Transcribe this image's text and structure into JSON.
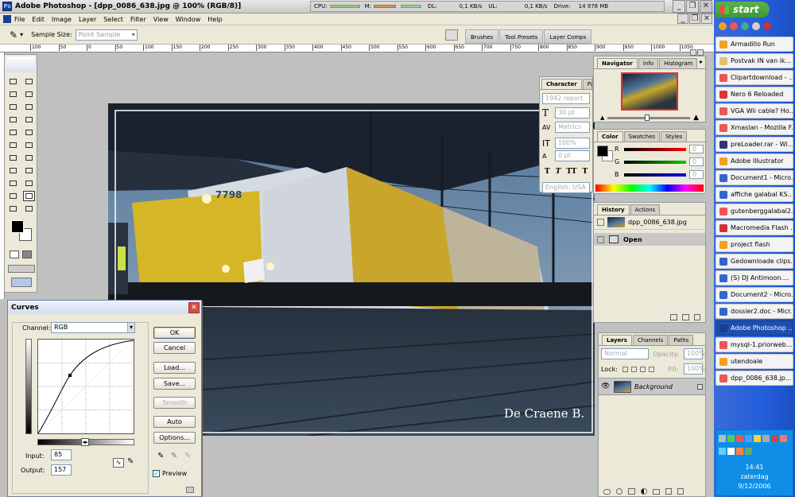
{
  "titlebar": {
    "app_title": "Adobe Photoshop - [dpp_0086_638.jpg @ 100% (RGB/8)]"
  },
  "sysmon": {
    "cpu_label": "CPU:",
    "mem_label": "M:",
    "dl_label": "DL:",
    "dl_value": "0,1 KB/s",
    "ul_label": "UL:",
    "ul_value": "0,1 KB/s",
    "drive_label": "Drive:",
    "drive_value": "14 978 MB"
  },
  "menu": [
    "File",
    "Edit",
    "Image",
    "Layer",
    "Select",
    "Filter",
    "View",
    "Window",
    "Help"
  ],
  "options": {
    "sample_label": "Sample Size:",
    "sample_value": "Point Sample"
  },
  "well_tabs": [
    "Brushes",
    "Tool Presets",
    "Layer Comps"
  ],
  "ruler": [
    "100",
    "50",
    "0",
    "50",
    "100",
    "150",
    "200",
    "250",
    "300",
    "350",
    "400",
    "450",
    "500",
    "550",
    "600",
    "650",
    "700",
    "750",
    "800",
    "850",
    "900",
    "950",
    "1000",
    "1050"
  ],
  "image": {
    "watermark": "De Craene B.",
    "loco_number": "7798"
  },
  "curves": {
    "title": "Curves",
    "channel_label": "Channel:",
    "channel_value": "RGB",
    "ok": "OK",
    "cancel": "Cancel",
    "load": "Load...",
    "save": "Save...",
    "smooth": "Smooth",
    "auto": "Auto",
    "options": "Options...",
    "input_label": "Input:",
    "input_value": "85",
    "output_label": "Output:",
    "output_value": "157",
    "preview_label": "Preview"
  },
  "character": {
    "tab1": "Character",
    "tab2": "Para",
    "font": "1942 report",
    "size": "30 pt",
    "tracking": "Metrics",
    "scale": "100%",
    "baseline": "0 pt",
    "styles": [
      "T",
      "T",
      "TT",
      "T"
    ],
    "language": "English: USA"
  },
  "navigator": {
    "tabs": [
      "Navigator",
      "Info",
      "Histogram"
    ]
  },
  "color": {
    "tabs": [
      "Color",
      "Swatches",
      "Styles"
    ],
    "r_label": "R",
    "g_label": "G",
    "b_label": "B",
    "r_value": "0",
    "g_value": "0",
    "b_value": "0"
  },
  "history": {
    "tabs": [
      "History",
      "Actions"
    ],
    "snapshot": "dpp_0086_638.jpg",
    "step": "Open"
  },
  "layers": {
    "tabs": [
      "Layers",
      "Channels",
      "Paths"
    ],
    "blend": "Normal",
    "opacity_label": "Opacity:",
    "opacity_value": "100%",
    "lock_label": "Lock:",
    "fill_label": "Fill:",
    "fill_value": "100%",
    "layer_name": "Background"
  },
  "taskbar": {
    "start": "start",
    "items": [
      "Armadillo Run",
      "Postvak IN van ik...",
      "Clipartdownload - ...",
      "Nero 6 Reloaded",
      "VGA Wii cable? Ho...",
      "Xmaslan - Mozilla F...",
      "preLoader.rar - Wi...",
      "Adobe Illustrator",
      "Document1 - Micro...",
      "affiche galabal KS...",
      "gutenberggalabal2...",
      "Macromedia Flash ...",
      "project flash",
      "Gedownloade clips...",
      "(S) DJ Antimoon....",
      "Document2 - Micro...",
      "dossier2.doc - Micr...",
      "Adobe Photoshop ...",
      "mysql-1.priorweb....",
      "utendoale",
      "dpp_0086_638.jp..."
    ],
    "active_index": 17,
    "time": "14:41",
    "day": "zaterdag",
    "date": "9/12/2006"
  },
  "colors": {
    "title_blue": "#0a246a",
    "taskbar_blue": "#245edb",
    "start_green": "#3c9a35",
    "curves_title": "#d8e4f8"
  }
}
